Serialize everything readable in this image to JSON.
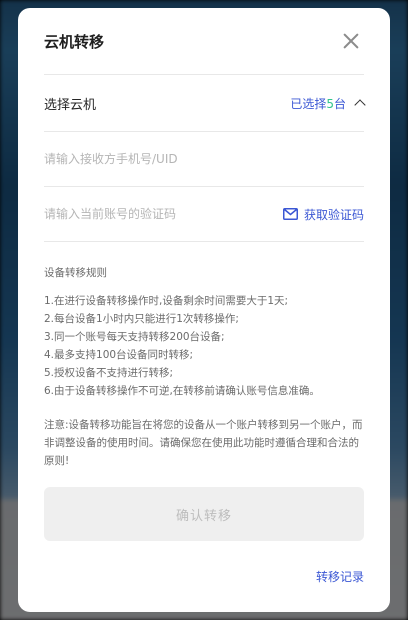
{
  "dialog": {
    "title": "云机转移",
    "select_label": "选择云机",
    "selected_prefix": "已选择",
    "selected_count": "5",
    "selected_suffix": "台",
    "receiver_placeholder": "请输入接收方手机号/UID",
    "code_placeholder": "请输入当前账号的验证码",
    "get_code_label": "获取验证码",
    "rules_title": "设备转移规则",
    "rules": [
      "1.在进行设备转移操作时,设备剩余时间需要大于1天;",
      "2.每台设备1小时内只能进行1次转移操作;",
      "3.同一个账号每天支持转移200台设备;",
      "4.最多支持100台设备同时转移;",
      "5.授权设备不支持进行转移;",
      "6.由于设备转移操作不可逆,在转移前请确认账号信息准确。"
    ],
    "note": "注意:设备转移功能旨在将您的设备从一个账户转移到另一个账户，而非调整设备的使用时间。请确保您在使用此功能时遵循合理和合法的原则!",
    "confirm_label": "确认转移",
    "history_label": "转移记录"
  },
  "colors": {
    "accent": "#3b57d4",
    "count": "#31c48d",
    "disabled_bg": "#efefef"
  }
}
